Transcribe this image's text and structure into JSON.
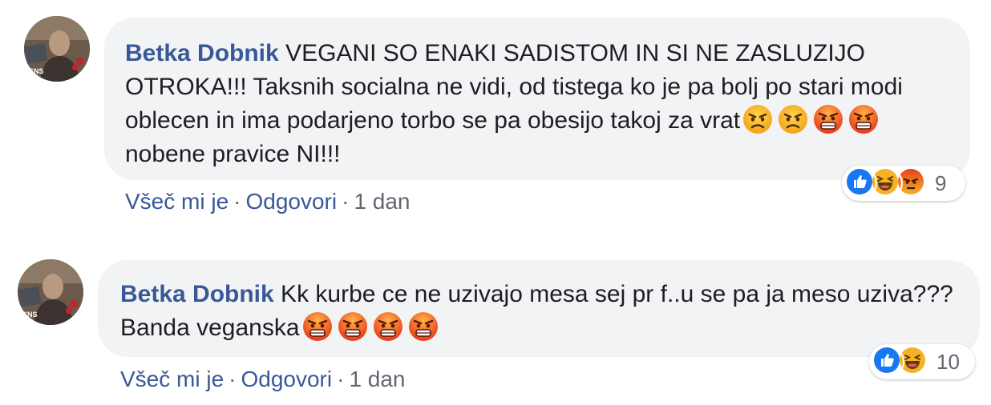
{
  "comments": [
    {
      "author": "Betka Dobnik",
      "text_part1": " VEGANI SO ENAKI SADISTOM IN SI NE ZASLUZIJO OTROKA!!! Taksnih socialna ne vidi, od tistega ko je pa bolj po stari modi oblecen in ima podarjeno torbo se pa obesijo takoj za vrat",
      "text_part2": " nobene pravice NI!!!",
      "emojis": [
        "angry-face-icon",
        "angry-face-icon",
        "pouting-face-icon",
        "pouting-face-icon"
      ],
      "reactions": [
        "like-reaction-icon",
        "haha-reaction-icon",
        "angry-reaction-icon"
      ],
      "reaction_count": "9",
      "like_label": "Všeč mi je",
      "reply_label": "Odgovori",
      "time": "1 dan",
      "avatar_badge": "SNS"
    },
    {
      "author": "Betka Dobnik",
      "text_part1": " Kk kurbe ce ne uzivajo mesa sej pr f..u se pa ja meso uziva??? Banda veganska",
      "text_part2": "",
      "emojis": [
        "pouting-face-icon",
        "pouting-face-icon",
        "pouting-face-icon",
        "pouting-face-icon"
      ],
      "reactions": [
        "like-reaction-icon",
        "haha-reaction-icon"
      ],
      "reaction_count": "10",
      "like_label": "Všeč mi je",
      "reply_label": "Odgovori",
      "time": "1 dan",
      "avatar_badge": "SNS"
    }
  ],
  "colors": {
    "author": "#385898",
    "bubble": "#f2f3f5",
    "text": "#1c1e21",
    "meta": "#606770",
    "like": "#1877f2",
    "haha": "#f7b125",
    "angry": "#e9710f"
  }
}
